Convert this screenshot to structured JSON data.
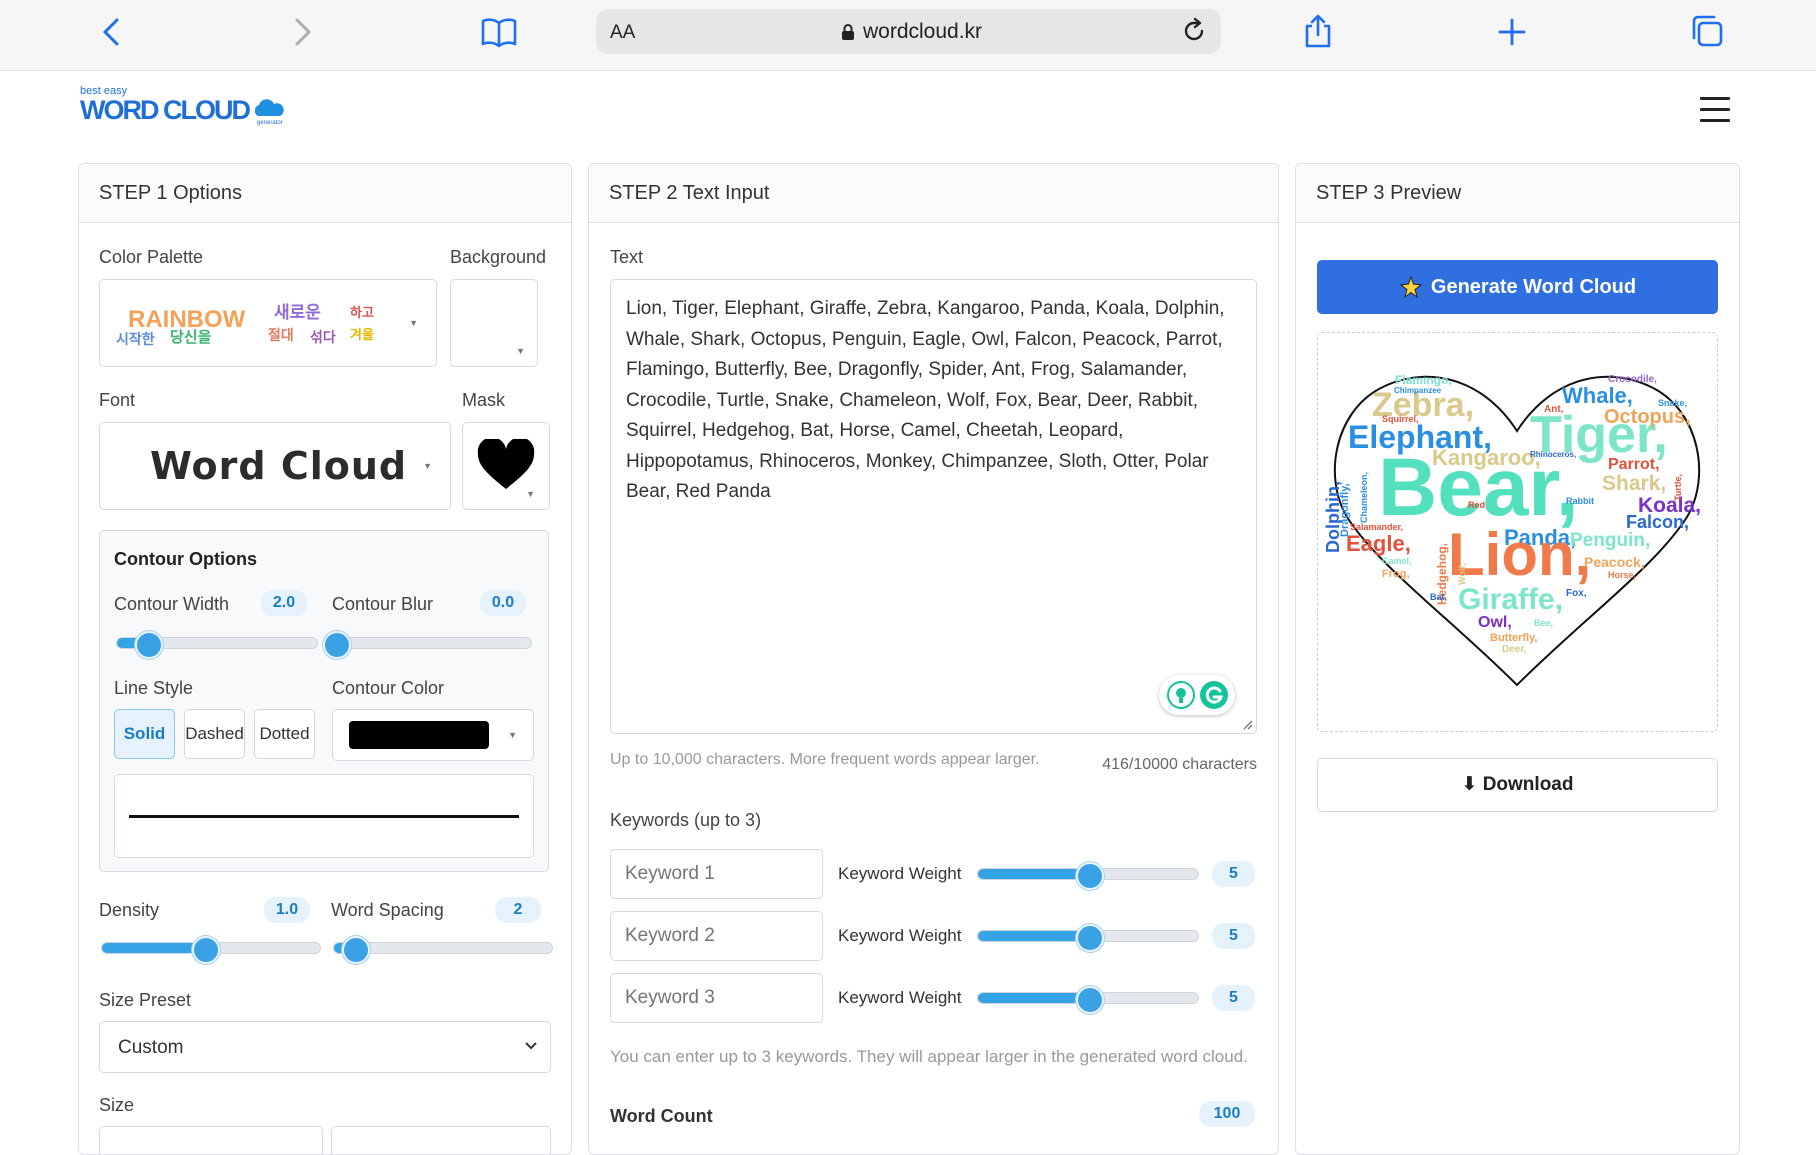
{
  "browser": {
    "text_size_label": "AA",
    "url": "wordcloud.kr"
  },
  "site": {
    "logo_small": "best easy",
    "logo_big": "WORD CLOUD",
    "logo_tag": "generator"
  },
  "step1": {
    "title": "STEP 1 Options",
    "color_palette_label": "Color Palette",
    "background_label": "Background",
    "palette_words": [
      "RAINBOW",
      "새로운",
      "하고",
      "시작한",
      "당신을",
      "절대",
      "섞다",
      "겨울"
    ],
    "font_label": "Font",
    "font_preview": "Word Cloud",
    "mask_label": "Mask",
    "contour": {
      "title": "Contour Options",
      "width_label": "Contour Width",
      "width_value": "2.0",
      "width_level": 0.15,
      "blur_label": "Contour Blur",
      "blur_value": "0.0",
      "blur_level": 0.0,
      "line_style_label": "Line Style",
      "line_styles": [
        "Solid",
        "Dashed",
        "Dotted"
      ],
      "contour_color_label": "Contour Color",
      "contour_color": "#000000"
    },
    "density_label": "Density",
    "density_value": "1.0",
    "density_level": 0.47,
    "word_spacing_label": "Word Spacing",
    "word_spacing_value": "2",
    "word_spacing_level": 0.09,
    "size_preset_label": "Size Preset",
    "size_preset_value": "Custom",
    "size_label": "Size"
  },
  "step2": {
    "title": "STEP 2 Text Input",
    "text_label": "Text",
    "text_value": "Lion, Tiger, Elephant, Giraffe, Zebra, Kangaroo, Panda, Koala, Dolphin, Whale, Shark, Octopus, Penguin, Eagle, Owl, Falcon, Peacock, Parrot, Flamingo, Butterfly, Bee, Dragonfly, Spider, Ant, Frog, Salamander, Crocodile, Turtle, Snake, Chameleon, Wolf, Fox, Bear, Deer, Rabbit, Squirrel, Hedgehog, Bat, Horse, Camel, Cheetah, Leopard, Hippopotamus, Rhinoceros, Monkey, Chimpanzee, Sloth, Otter, Polar Bear, Red Panda",
    "text_help": "Up to 10,000 characters. More frequent words appear larger.",
    "char_count": "416/10000 characters",
    "keywords_label": "Keywords (up to 3)",
    "keywords": [
      {
        "placeholder": "Keyword 1",
        "weight_label": "Keyword Weight",
        "weight": "5",
        "level": 0.5
      },
      {
        "placeholder": "Keyword 2",
        "weight_label": "Keyword Weight",
        "weight": "5",
        "level": 0.5
      },
      {
        "placeholder": "Keyword 3",
        "weight_label": "Keyword Weight",
        "weight": "5",
        "level": 0.5
      }
    ],
    "keywords_help": "You can enter up to 3 keywords. They will appear larger in the generated word cloud.",
    "word_count_label": "Word Count",
    "word_count_value": "100"
  },
  "step3": {
    "title": "STEP 3 Preview",
    "generate_label": "Generate Word Cloud",
    "download_label": "Download",
    "cloud_words": [
      "Flamingo,",
      "Zebra,",
      "Elephant,",
      "Tiger,",
      "Whale,",
      "Octopus,",
      "Crocodile,",
      "Snake,",
      "Bear,",
      "Kangaroo,",
      "Parrot,",
      "Shark,",
      "Koala,",
      "Falcon,",
      "Dolphin,",
      "Panda,",
      "Penguin,",
      "Eagle,",
      "Lion,",
      "Peacock,",
      "Giraffe,",
      "Owl,",
      "Butterfly,",
      "Deer,",
      "Dragonfly,",
      "Chameleon,",
      "Squirrel,",
      "Hedgehog,",
      "Salamander,",
      "Frog,",
      "Bat,",
      "Fox,",
      "Bee,",
      "Horse,",
      "Turtle,",
      "Ant,",
      "Red",
      "Rabbit",
      "Camel,",
      "Wolf,",
      "Rhinoceros,",
      "Chimpanzee"
    ]
  },
  "colors": {
    "accent": "#2f6fe0",
    "slider": "#35a4e6",
    "badge_text": "#1a7dc4"
  }
}
